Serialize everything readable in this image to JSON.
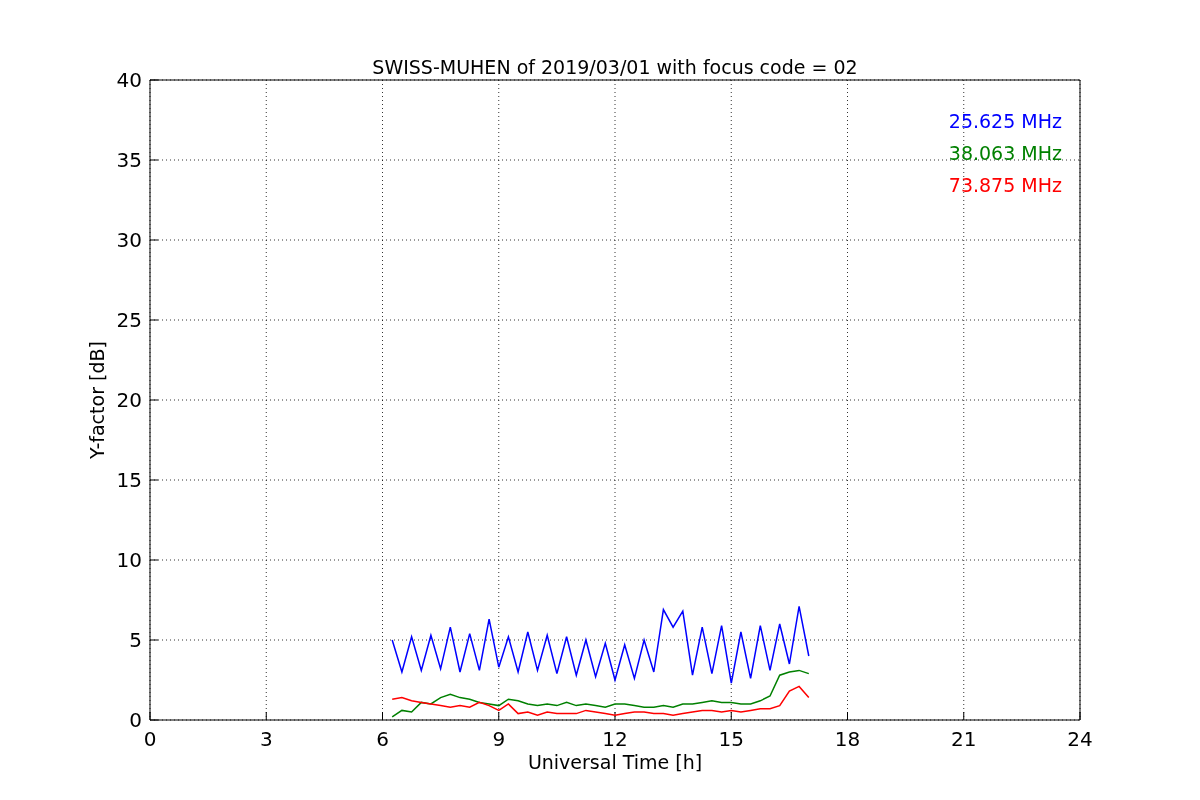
{
  "chart_data": {
    "type": "line",
    "title": "SWISS-MUHEN of 2019/03/01 with focus code = 02",
    "xlabel": "Universal Time [h]",
    "ylabel": "Y-factor [dB]",
    "x": [
      6.25,
      6.5,
      6.75,
      7.0,
      7.25,
      7.5,
      7.75,
      8.0,
      8.25,
      8.5,
      8.75,
      9.0,
      9.25,
      9.5,
      9.75,
      10.0,
      10.25,
      10.5,
      10.75,
      11.0,
      11.25,
      11.5,
      11.75,
      12.0,
      12.25,
      12.5,
      12.75,
      13.0,
      13.25,
      13.5,
      13.75,
      14.0,
      14.25,
      14.5,
      14.75,
      15.0,
      15.25,
      15.5,
      15.75,
      16.0,
      16.25,
      16.5,
      16.75,
      17.0
    ],
    "series": [
      {
        "name": "25.625 MHz",
        "color": "#0000ff",
        "values": [
          5.0,
          3.0,
          5.2,
          3.1,
          5.3,
          3.2,
          5.8,
          3.0,
          5.4,
          3.1,
          6.3,
          3.3,
          5.2,
          3.0,
          5.5,
          3.1,
          5.3,
          2.9,
          5.2,
          2.8,
          5.0,
          2.7,
          4.8,
          2.5,
          4.7,
          2.6,
          5.0,
          3.0,
          6.9,
          5.8,
          6.8,
          2.8,
          5.8,
          2.9,
          5.9,
          2.3,
          5.5,
          2.6,
          5.9,
          3.1,
          6.0,
          3.5,
          7.1,
          4.0
        ]
      },
      {
        "name": "38.063 MHz",
        "color": "#008000",
        "values": [
          0.2,
          0.6,
          0.5,
          1.1,
          1.0,
          1.4,
          1.6,
          1.4,
          1.3,
          1.1,
          1.0,
          0.9,
          1.3,
          1.2,
          1.0,
          0.9,
          1.0,
          0.9,
          1.1,
          0.9,
          1.0,
          0.9,
          0.8,
          1.0,
          1.0,
          0.9,
          0.8,
          0.8,
          0.9,
          0.8,
          1.0,
          1.0,
          1.1,
          1.2,
          1.1,
          1.1,
          1.0,
          1.0,
          1.2,
          1.5,
          2.8,
          3.0,
          3.1,
          2.9
        ]
      },
      {
        "name": "73.875 MHz",
        "color": "#ff0000",
        "values": [
          1.3,
          1.4,
          1.2,
          1.1,
          1.0,
          0.9,
          0.8,
          0.9,
          0.8,
          1.1,
          0.9,
          0.6,
          1.0,
          0.4,
          0.5,
          0.3,
          0.5,
          0.4,
          0.4,
          0.4,
          0.6,
          0.5,
          0.4,
          0.3,
          0.4,
          0.5,
          0.5,
          0.4,
          0.4,
          0.3,
          0.4,
          0.5,
          0.6,
          0.6,
          0.5,
          0.6,
          0.5,
          0.6,
          0.7,
          0.7,
          0.9,
          1.8,
          2.1,
          1.4
        ]
      }
    ],
    "grid": true,
    "xlim": [
      0,
      24
    ],
    "ylim": [
      0,
      40
    ],
    "xticks": [
      0,
      3,
      6,
      9,
      12,
      15,
      18,
      21,
      24
    ],
    "yticks": [
      0,
      5,
      10,
      15,
      20,
      25,
      30,
      35,
      40
    ]
  }
}
